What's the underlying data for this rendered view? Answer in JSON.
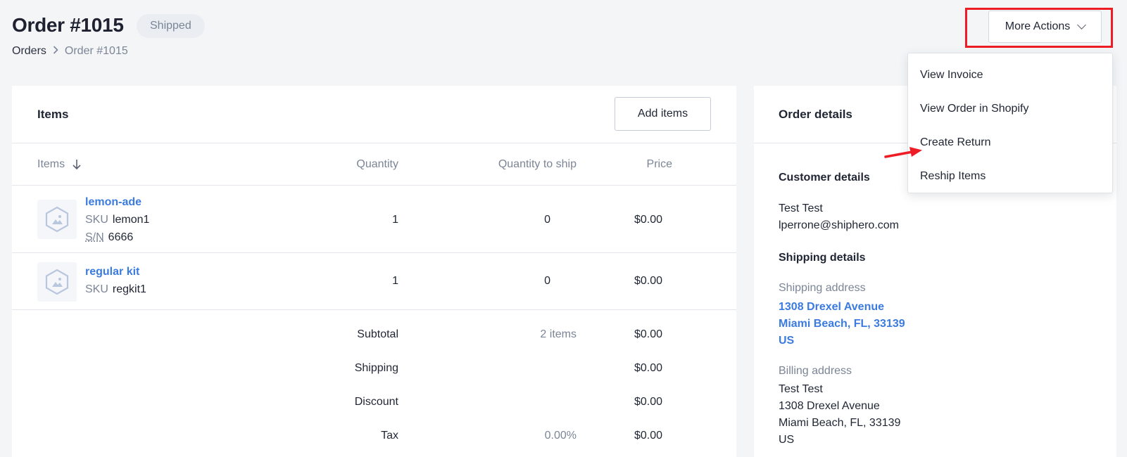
{
  "header": {
    "title": "Order #1015",
    "status": "Shipped",
    "more_actions_label": "More Actions",
    "icons": {
      "chevron": "chevron-down-icon",
      "breadcrumb_separator": "chevron-right-icon"
    }
  },
  "breadcrumb": {
    "parent": "Orders",
    "current": "Order #1015"
  },
  "dropdown": {
    "items": [
      "View Invoice",
      "View Order in Shopify",
      "Create Return",
      "Reship Items"
    ]
  },
  "items_card": {
    "title": "Items",
    "add_items_label": "Add items",
    "columns": {
      "items": "Items",
      "quantity": "Quantity",
      "quantity_to_ship": "Quantity to ship",
      "price": "Price"
    },
    "sku_key": "SKU",
    "sn_key": "S/N",
    "rows": [
      {
        "name": "lemon-ade",
        "sku": "lemon1",
        "sn": "6666",
        "quantity": "1",
        "quantity_to_ship": "0",
        "price": "$0.00"
      },
      {
        "name": "regular kit",
        "sku": "regkit1",
        "quantity": "1",
        "quantity_to_ship": "0",
        "price": "$0.00"
      }
    ],
    "totals": {
      "subtotal_label": "Subtotal",
      "subtotal_items": "2 items",
      "subtotal_value": "$0.00",
      "shipping_label": "Shipping",
      "shipping_value": "$0.00",
      "discount_label": "Discount",
      "discount_value": "$0.00",
      "tax_label": "Tax",
      "tax_rate": "0.00%",
      "tax_value": "$0.00"
    }
  },
  "order_details": {
    "title": "Order details",
    "customer_heading": "Customer details",
    "customer_name": "Test Test",
    "customer_email": "lperrone@shiphero.com",
    "shipping_heading": "Shipping details",
    "shipping_address_label": "Shipping address",
    "shipping_address": [
      "1308 Drexel Avenue",
      "Miami Beach, FL, 33139",
      "US"
    ],
    "billing_address_label": "Billing address",
    "billing_address": [
      "Test Test",
      "1308 Drexel Avenue",
      "Miami Beach, FL, 33139",
      "US"
    ]
  },
  "colors": {
    "accent_link": "#3b7be0",
    "highlight_red": "#ee1c24",
    "background": "#f4f5f7"
  }
}
